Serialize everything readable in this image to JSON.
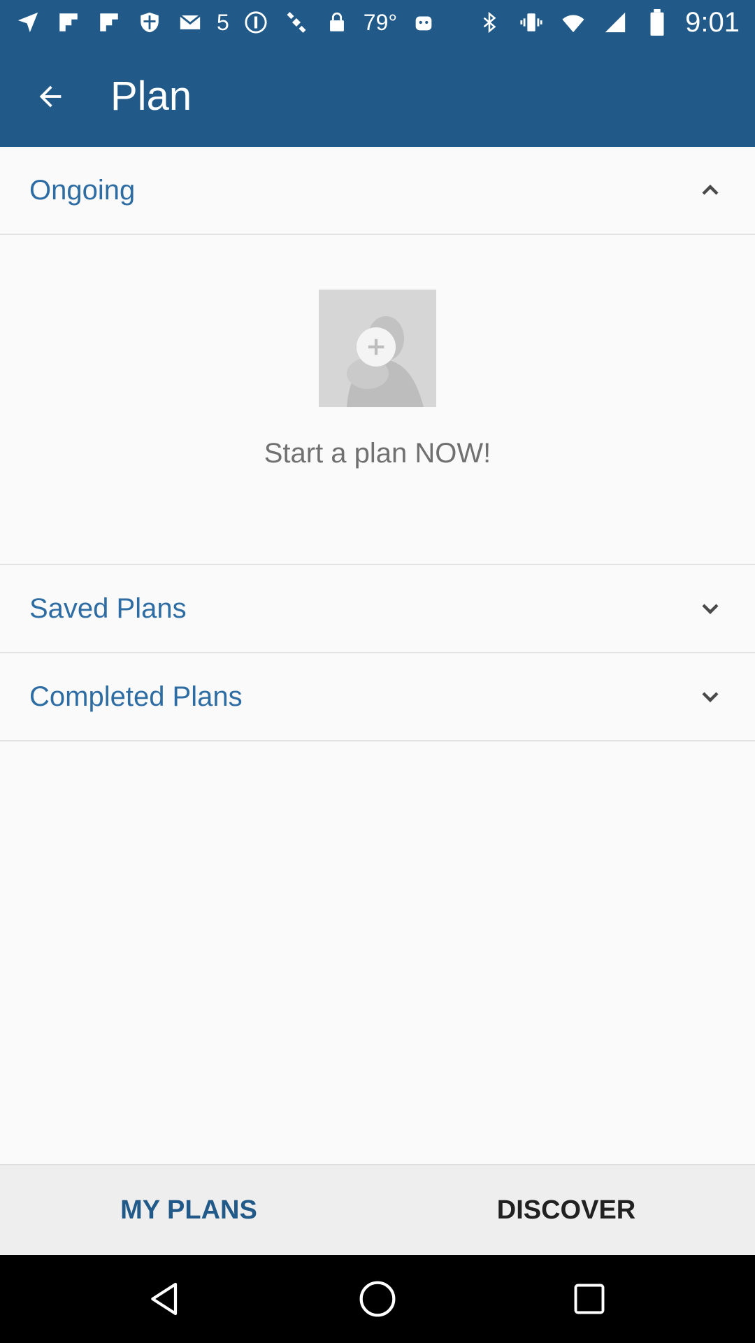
{
  "status_bar": {
    "temperature": "79°",
    "badge_number": "5",
    "time": "9:01",
    "icons": [
      "navigation-icon",
      "flipboard-icon",
      "shield-icon",
      "mail-icon",
      "info-icon",
      "satellite-icon",
      "lock-icon",
      "android-icon",
      "bluetooth-icon",
      "vibrate-icon",
      "wifi-icon",
      "signal-icon",
      "battery-icon"
    ]
  },
  "app_bar": {
    "title": "Plan"
  },
  "sections": {
    "ongoing": {
      "label": "Ongoing",
      "expanded": true
    },
    "saved": {
      "label": "Saved Plans",
      "expanded": false
    },
    "completed": {
      "label": "Completed Plans",
      "expanded": false
    }
  },
  "empty_state": {
    "message": "Start a plan NOW!"
  },
  "tabs": {
    "my_plans": "MY PLANS",
    "discover": "DISCOVER",
    "active_color": "#215a89"
  },
  "colors": {
    "primary": "#215a89",
    "section_text": "#2e6da4"
  }
}
